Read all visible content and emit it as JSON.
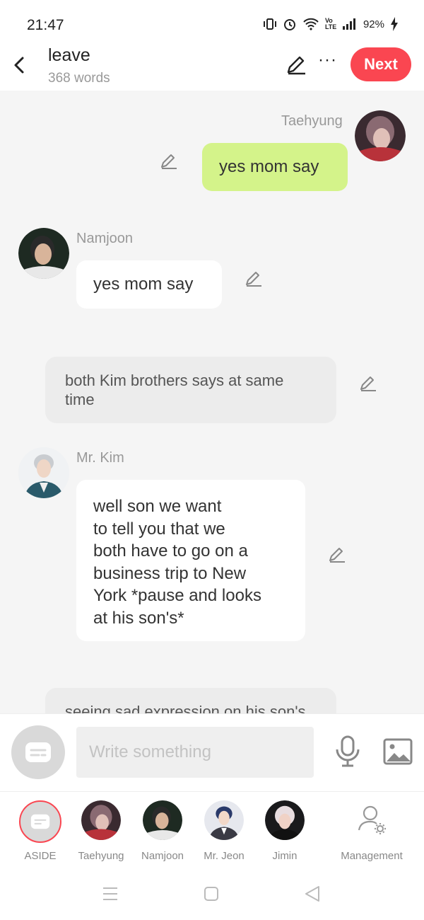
{
  "status": {
    "time": "21:47",
    "battery": "92%",
    "lte": "Vo LTE"
  },
  "header": {
    "title": "leave",
    "subtitle": "368 words",
    "next_label": "Next"
  },
  "messages": {
    "m1": {
      "name": "Taehyung",
      "text": "yes mom say"
    },
    "m2": {
      "name": "Namjoon",
      "text": "yes mom say"
    },
    "m3": {
      "text": "both Kim brothers says at same time"
    },
    "m4": {
      "name": "Mr. Kim",
      "lines": [
        "well son we want",
        "to tell you that we",
        "both have to go on a",
        "business trip to New",
        "York *pause and looks",
        "at his son's*"
      ]
    },
    "m5": {
      "text": "seeing sad expression on his son's"
    }
  },
  "composer": {
    "placeholder": "Write something"
  },
  "characters": [
    {
      "label": "ASIDE"
    },
    {
      "label": "Taehyung"
    },
    {
      "label": "Namjoon"
    },
    {
      "label": "Mr. Jeon"
    },
    {
      "label": "Jimin"
    },
    {
      "label": "Management"
    }
  ],
  "colors": {
    "accent": "#fa4651",
    "bubble_green": "#d4f38a",
    "chat_bg": "#f5f5f5"
  }
}
